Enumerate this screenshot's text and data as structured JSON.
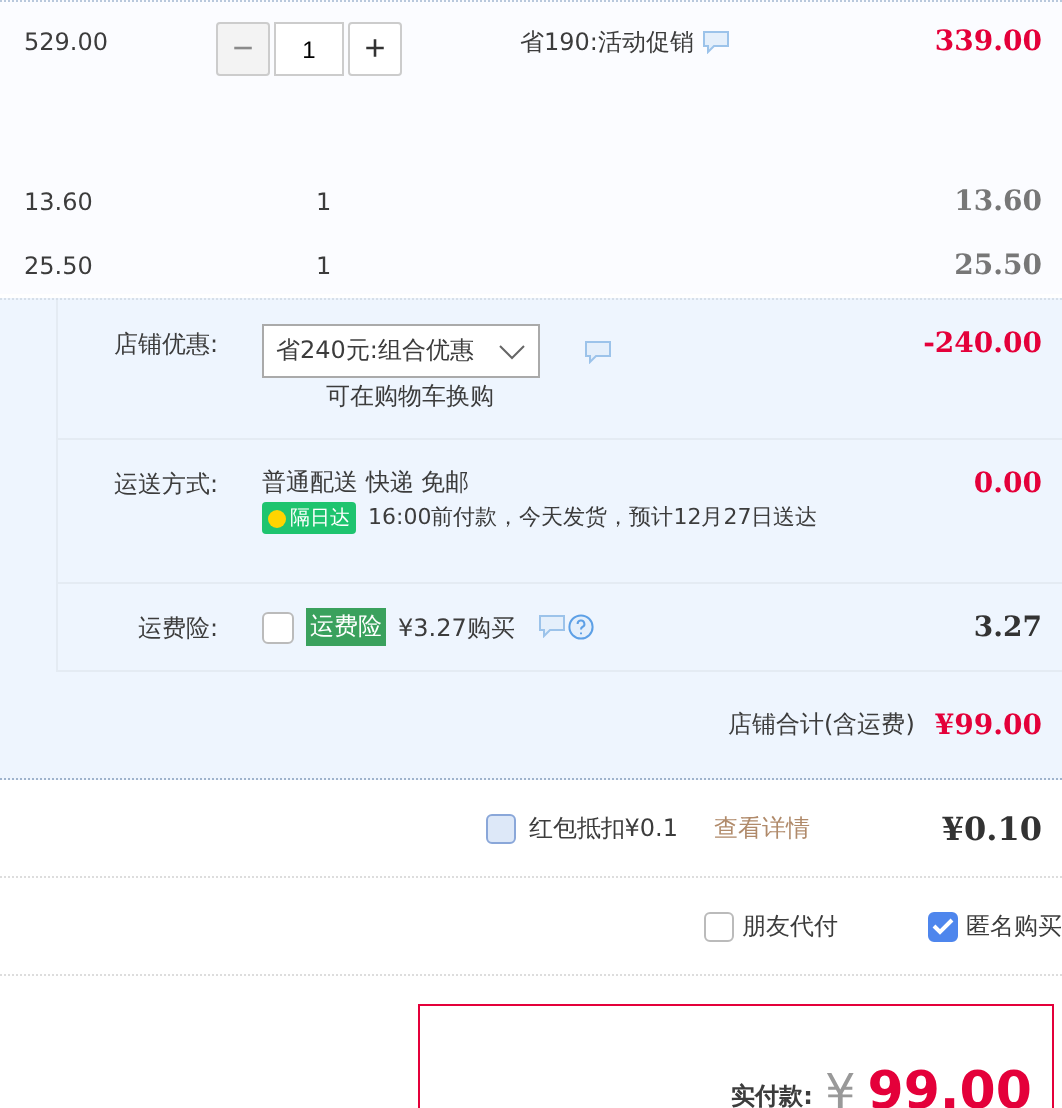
{
  "items": [
    {
      "kind": "stepper",
      "price": "529.00",
      "minus": "−",
      "quantity": "1",
      "minus_disabled": true,
      "plus": "+",
      "promo": "省190:活动促销",
      "subtotal": "339.00",
      "highlight": true
    },
    {
      "kind": "plain",
      "price": "13.60",
      "quantity": "1",
      "subtotal": "13.60",
      "highlight": false
    },
    {
      "kind": "plain",
      "price": "25.50",
      "quantity": "1",
      "subtotal": "25.50",
      "highlight": false
    }
  ],
  "shop_discount": {
    "label": "店铺优惠:",
    "select": "省240元:组合优惠",
    "note": "可在购物车换购",
    "amount": "-240.00"
  },
  "shipping": {
    "label": "运送方式:",
    "method": "普通配送 快递 免邮",
    "badge": "隔日达",
    "note": "16:00前付款，今天发货，预计12月27日送达",
    "amount": "0.00"
  },
  "insurance": {
    "label": "运费险:",
    "checked": false,
    "tag": "运费险",
    "text": "¥3.27购买",
    "amount": "3.27"
  },
  "shop_total": {
    "label": "店铺合计(含运费)",
    "amount": "¥99.00"
  },
  "red_packet": {
    "checked": false,
    "label": "红包抵扣¥0.1",
    "link": "查看详情",
    "amount": "¥0.10"
  },
  "options": [
    {
      "label": "朋友代付",
      "checked": false
    },
    {
      "label": "匿名购买",
      "checked": true
    }
  ],
  "payment": {
    "label": "实付款:",
    "currency": "¥",
    "amount": "99.00"
  }
}
